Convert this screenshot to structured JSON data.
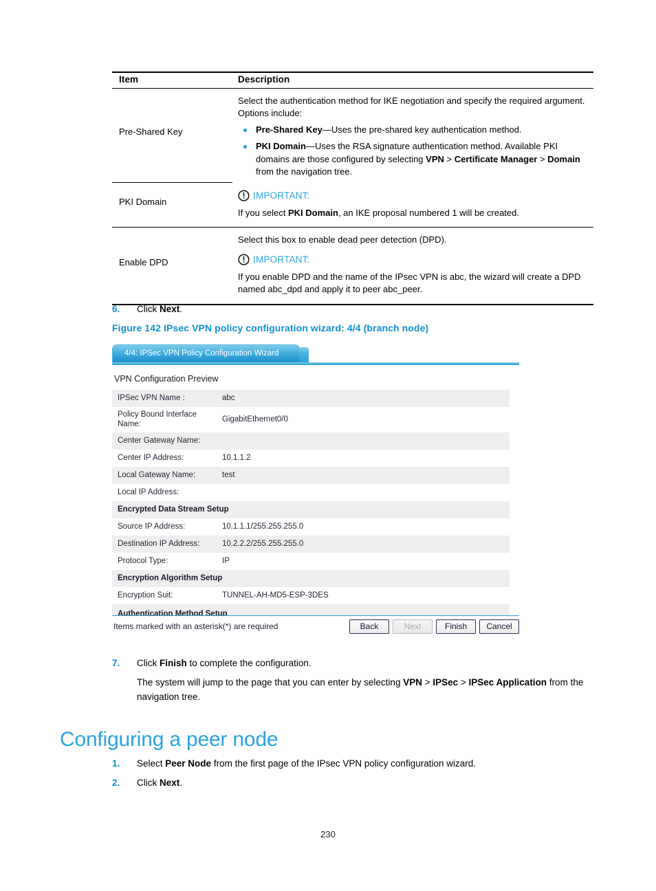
{
  "reference_table": {
    "headers": {
      "item": "Item",
      "description": "Description"
    },
    "rows": [
      {
        "item": "Pre-Shared Key",
        "intro": "Select the authentication method for IKE negotiation and specify the required argument. Options include:",
        "bullets": [
          {
            "term": "Pre-Shared Key",
            "dash": "—",
            "text": "Uses the pre-shared key authentication method."
          },
          {
            "term": "PKI Domain",
            "dash": "—",
            "text_before": "Uses the RSA signature authentication method. Available PKI domains are those configured by selecting ",
            "nav": [
              "VPN",
              "Certificate Manager",
              "Domain"
            ],
            "text_after": " from the navigation tree."
          }
        ]
      },
      {
        "item": "PKI Domain",
        "important_label": "IMPORTANT:",
        "note_before": "If you select ",
        "note_bold": "PKI Domain",
        "note_after": ", an IKE proposal numbered 1 will be created."
      },
      {
        "item": "Enable DPD",
        "intro": "Select this box to enable dead peer detection (DPD).",
        "important_label": "IMPORTANT:",
        "note": "If you enable DPD and the name of the IPsec VPN is abc, the wizard will create a DPD named abc_dpd and apply it to peer abc_peer."
      }
    ]
  },
  "step6": {
    "num": "6.",
    "before": "Click ",
    "bold": "Next",
    "after": "."
  },
  "figure": {
    "caption": "Figure 142 IPsec VPN policy configuration wizard: 4/4 (branch node)",
    "tab_label": "4/4: IPSec VPN Policy Configuration Wizard",
    "preview_title": "VPN Configuration Preview",
    "rows": [
      {
        "type": "field",
        "key": "IPSec VPN Name :",
        "value": "abc"
      },
      {
        "type": "field",
        "key": "Policy Bound Interface Name:",
        "value": "GigabitEthernet0/0"
      },
      {
        "type": "field",
        "key": "Center Gateway Name:",
        "value": ""
      },
      {
        "type": "field",
        "key": "Center IP Address:",
        "value": "10.1.1.2"
      },
      {
        "type": "field",
        "key": "Local Gateway Name:",
        "value": "test"
      },
      {
        "type": "field",
        "key": "Local IP Address:",
        "value": ""
      },
      {
        "type": "section",
        "key": "Encrypted Data Stream Setup",
        "value": ""
      },
      {
        "type": "field",
        "key": "Source IP Address:",
        "value": "10.1.1.1/255.255.255.0"
      },
      {
        "type": "field",
        "key": "Destination IP Address:",
        "value": "10.2.2.2/255.255.255.0"
      },
      {
        "type": "field",
        "key": "Protocol Type:",
        "value": "IP"
      },
      {
        "type": "section",
        "key": "Encryption Algorithm Setup",
        "value": ""
      },
      {
        "type": "field",
        "key": "Encryption Suit:",
        "value": "TUNNEL-AH-MD5-ESP-3DES"
      },
      {
        "type": "section",
        "key": "Authentication Method Setup",
        "value": ""
      }
    ],
    "footer_note": "Items marked with an asterisk(*) are required",
    "buttons": [
      {
        "label": "Back",
        "disabled": false
      },
      {
        "label": "Next",
        "disabled": true
      },
      {
        "label": "Finish",
        "disabled": false
      },
      {
        "label": "Cancel",
        "disabled": false
      }
    ]
  },
  "step7": {
    "num": "7.",
    "before": "Click ",
    "bold": "Finish",
    "after": " to complete the configuration.",
    "para_before": "The system will jump to the page that you can enter by selecting ",
    "nav": [
      "VPN",
      "IPSec",
      "IPSec Application"
    ],
    "para_after": " from the navigation tree."
  },
  "section": {
    "heading": "Configuring a peer node"
  },
  "peer_steps": [
    {
      "num": "1.",
      "before": "Select ",
      "bold": "Peer Node",
      "after": " from the first page of the IPsec VPN policy configuration wizard."
    },
    {
      "num": "2.",
      "before": "Click ",
      "bold": "Next",
      "after": "."
    }
  ],
  "page_number": "230",
  "colors": {
    "accent_blue": "#29a3dd",
    "heading_blue": "#0f8fd0",
    "bullet_blue": "#2196d4",
    "row_stripe": "#eeeeee"
  }
}
